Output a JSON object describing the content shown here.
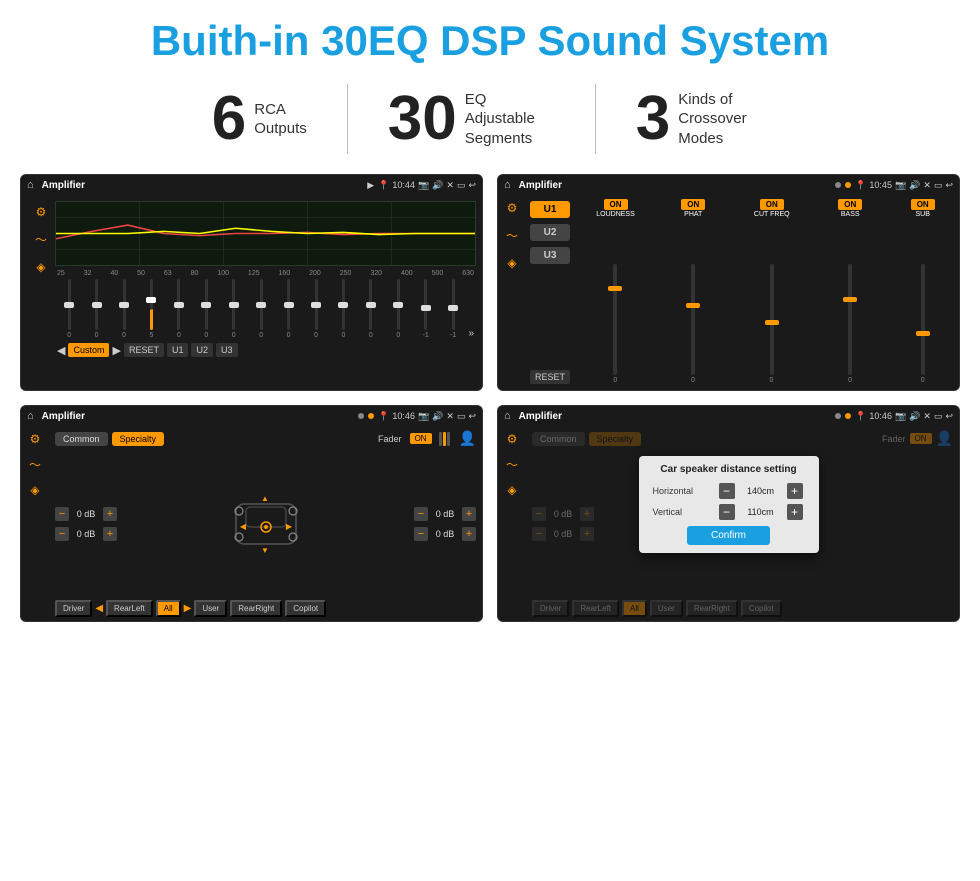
{
  "header": {
    "title": "Buith-in 30EQ DSP Sound System"
  },
  "stats": [
    {
      "number": "6",
      "label_line1": "RCA",
      "label_line2": "Outputs"
    },
    {
      "number": "30",
      "label_line1": "EQ Adjustable",
      "label_line2": "Segments"
    },
    {
      "number": "3",
      "label_line1": "Kinds of",
      "label_line2": "Crossover Modes"
    }
  ],
  "screens": {
    "eq": {
      "app_name": "Amplifier",
      "time": "10:44",
      "freq_labels": [
        "25",
        "32",
        "40",
        "50",
        "63",
        "80",
        "100",
        "125",
        "160",
        "200",
        "250",
        "320",
        "400",
        "500",
        "630"
      ],
      "values": [
        "0",
        "0",
        "0",
        "5",
        "0",
        "0",
        "0",
        "0",
        "0",
        "0",
        "0",
        "0",
        "0",
        "-1",
        "0",
        "-1"
      ],
      "buttons": [
        "Custom",
        "RESET",
        "U1",
        "U2",
        "U3"
      ]
    },
    "crossover": {
      "app_name": "Amplifier",
      "time": "10:45",
      "u_labels": [
        "U1",
        "U2",
        "U3"
      ],
      "channels": [
        "LOUDNESS",
        "PHAT",
        "CUT FREQ",
        "BASS",
        "SUB"
      ],
      "on_labels": [
        "ON",
        "ON",
        "ON",
        "ON",
        "ON"
      ],
      "reset_label": "RESET"
    },
    "fader": {
      "app_name": "Amplifier",
      "time": "10:46",
      "tabs": [
        "Common",
        "Specialty"
      ],
      "fader_label": "Fader",
      "on_label": "ON",
      "db_values": [
        "0 dB",
        "0 dB",
        "0 dB",
        "0 dB"
      ],
      "buttons": [
        "Driver",
        "RearLeft",
        "All",
        "User",
        "RearRight",
        "Copilot"
      ]
    },
    "dialog": {
      "app_name": "Amplifier",
      "time": "10:46",
      "dialog_title": "Car speaker distance setting",
      "horizontal_label": "Horizontal",
      "horizontal_value": "140cm",
      "vertical_label": "Vertical",
      "vertical_value": "110cm",
      "confirm_label": "Confirm",
      "buttons": [
        "Driver",
        "RearLeft",
        "All",
        "User",
        "RearRight",
        "Copilot"
      ],
      "db_values": [
        "0 dB",
        "0 dB"
      ]
    }
  }
}
